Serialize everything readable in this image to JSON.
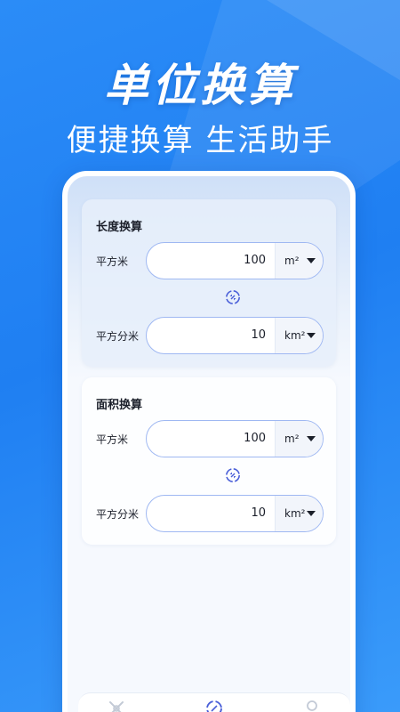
{
  "promo": {
    "headline": "单位换算",
    "subheadline": "便捷换算 生活助手"
  },
  "cards": [
    {
      "title": "长度换算",
      "rows": [
        {
          "label": "平方米",
          "value": "100",
          "unit": "m²"
        },
        {
          "label": "平方分米",
          "value": "10",
          "unit": "km²"
        }
      ]
    },
    {
      "title": "面积换算",
      "rows": [
        {
          "label": "平方米",
          "value": "100",
          "unit": "m²"
        },
        {
          "label": "平方分米",
          "value": "10",
          "unit": "km²"
        }
      ]
    }
  ],
  "icons": {
    "swap": "swap-icon",
    "tab_tools": "tools-icon",
    "tab_convert": "convert-icon",
    "tab_profile": "profile-icon"
  },
  "colors": {
    "background": "#2184f4",
    "accent": "#4a5fd8",
    "field_border": "#9fb8f2"
  }
}
